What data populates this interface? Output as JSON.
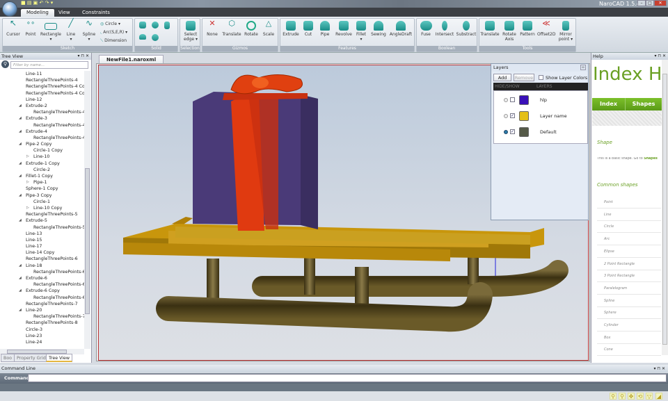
{
  "app": {
    "title": "NaroCAD 1.5.4",
    "window_controls": [
      "minimize",
      "maximize",
      "close"
    ]
  },
  "ribbon": {
    "tabs": [
      {
        "label": "Modeling",
        "active": true
      },
      {
        "label": "View"
      },
      {
        "label": "Constraints"
      }
    ],
    "groups": [
      {
        "label": "Sketch",
        "tools": [
          "Cursor",
          "Point",
          "Rectangle",
          "Line",
          "Spline"
        ],
        "small_tools": [
          "Circle",
          "Arc(S,E,R)",
          "Dimension"
        ]
      },
      {
        "label": "Solid"
      },
      {
        "label": "Selection",
        "tools": [
          "Select edge"
        ]
      },
      {
        "label": "Gizmos",
        "tools": [
          "None",
          "Translate",
          "Rotate",
          "Scale"
        ]
      },
      {
        "label": "Features",
        "tools": [
          "Extrude",
          "Cut",
          "Pipe",
          "Revolve",
          "Fillet",
          "Sewing",
          "AngleDraft"
        ]
      },
      {
        "label": "Boolean",
        "tools": [
          "Fuse",
          "Intersect",
          "Substract"
        ]
      },
      {
        "label": "Tools",
        "tools": [
          "Translate",
          "Rotate Axis",
          "Pattern",
          "Offset2D",
          "Mirror point"
        ]
      }
    ]
  },
  "tree": {
    "title": "Tree View",
    "filter_placeholder": "Filter by name...",
    "items": [
      {
        "label": "Line-11",
        "level": 1
      },
      {
        "label": "RectangleThreePoints-4",
        "level": 1
      },
      {
        "label": "RectangleThreePoints-4 Co",
        "level": 1
      },
      {
        "label": "RectangleThreePoints-4 Co",
        "level": 1
      },
      {
        "label": "Line-12",
        "level": 1
      },
      {
        "label": "Extrude-2",
        "level": 1,
        "exp": "open"
      },
      {
        "label": "RectangleThreePoints-4",
        "level": 2
      },
      {
        "label": "Extrude-3",
        "level": 1,
        "exp": "open"
      },
      {
        "label": "RectangleThreePoints-4",
        "level": 2
      },
      {
        "label": "Extrude-4",
        "level": 1,
        "exp": "open"
      },
      {
        "label": "RectangleThreePoints-4",
        "level": 2
      },
      {
        "label": "Pipe-2 Copy",
        "level": 1,
        "exp": "open"
      },
      {
        "label": "Circle-1 Copy",
        "level": 2
      },
      {
        "label": "Line-10",
        "level": 2,
        "exp": "closed"
      },
      {
        "label": "Extrude-1 Copy",
        "level": 1,
        "exp": "open"
      },
      {
        "label": "Circle-2",
        "level": 2
      },
      {
        "label": "Fillet-1 Copy",
        "level": 1,
        "exp": "open"
      },
      {
        "label": "Pipe-1",
        "level": 2,
        "exp": "closed"
      },
      {
        "label": "Sphere-1 Copy",
        "level": 1
      },
      {
        "label": "Pipe-3 Copy",
        "level": 1,
        "exp": "open"
      },
      {
        "label": "Circle-1",
        "level": 2
      },
      {
        "label": "Line-10 Copy",
        "level": 2,
        "exp": "closed"
      },
      {
        "label": "RectangleThreePoints-5",
        "level": 1
      },
      {
        "label": "Extrude-5",
        "level": 1,
        "exp": "open"
      },
      {
        "label": "RectangleThreePoints-5",
        "level": 2
      },
      {
        "label": "Line-13",
        "level": 1
      },
      {
        "label": "Line-15",
        "level": 1
      },
      {
        "label": "Line-17",
        "level": 1
      },
      {
        "label": "Line-14 Copy",
        "level": 1
      },
      {
        "label": "RectangleThreePoints-6",
        "level": 1
      },
      {
        "label": "Line-18",
        "level": 1,
        "exp": "open"
      },
      {
        "label": "RectangleThreePoints-6",
        "level": 2
      },
      {
        "label": "Extrude-6",
        "level": 1,
        "exp": "open"
      },
      {
        "label": "RectangleThreePoints-6",
        "level": 2
      },
      {
        "label": "Extrude-6 Copy",
        "level": 1,
        "exp": "open"
      },
      {
        "label": "RectangleThreePoints-6",
        "level": 2
      },
      {
        "label": "RectangleThreePoints-7",
        "level": 1
      },
      {
        "label": "Line-20",
        "level": 1,
        "exp": "open"
      },
      {
        "label": "RectangleThreePoints-7",
        "level": 2
      },
      {
        "label": "RectangleThreePoints-8",
        "level": 1
      },
      {
        "label": "Circle-3",
        "level": 1
      },
      {
        "label": "Line-23",
        "level": 1
      },
      {
        "label": "Line-24",
        "level": 1
      }
    ],
    "bottom_tabs": [
      {
        "label": "Boo"
      },
      {
        "label": "Property Grid"
      },
      {
        "label": "Tree View",
        "active": true
      }
    ]
  },
  "document": {
    "tab": "NewFile1.naroxml"
  },
  "layers": {
    "title": "Layers",
    "add": "Add",
    "remove": "Remove",
    "show_colors": "Show Layer Colors",
    "col_hide": "HIDE/SHOW",
    "col_layers": "LAYERS",
    "rows": [
      {
        "name": "hlp",
        "color": "#3a10b8",
        "visible": false,
        "active": false
      },
      {
        "name": "Layer name",
        "color": "#e4c018",
        "visible": true,
        "active": false
      },
      {
        "name": "Default",
        "color": "#555a48",
        "visible": true,
        "active": true
      }
    ]
  },
  "help": {
    "title": "Help",
    "heading": "Index He",
    "nav": [
      "Index",
      "Shapes"
    ],
    "shape_heading": "Shape",
    "shape_text": "This is a basic shape. Go to",
    "shape_link": "Shapes",
    "common_heading": "Common shapes",
    "items": [
      "Point",
      "Line",
      "Circle",
      "Arc",
      "Elipse",
      "2 Point Rectangle",
      "3 Point Rectangle",
      "Paralelogram",
      "Spline",
      "Sphere",
      "Cylinder",
      "Box",
      "Cone"
    ]
  },
  "command": {
    "title": "Command Line",
    "label": "Command:",
    "value": ""
  },
  "colors": {
    "accent": "#6aa024",
    "ribbon_icon": "#1b8d88",
    "viewport_border": "#b33333",
    "gift_box": "#4a3a78",
    "ribbon_bow": "#e03a10",
    "sled_wood": "#c8960c",
    "sled_runner": "#5a4a1c"
  }
}
